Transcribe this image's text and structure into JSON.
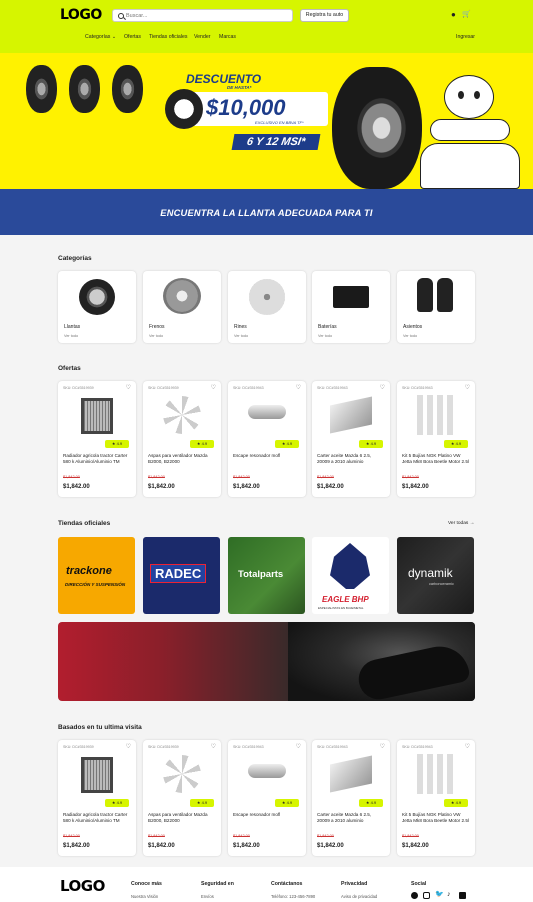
{
  "header": {
    "logo": "LOGO",
    "search_placeholder": "Buscar...",
    "register_label": "Registra tu auto",
    "nav": [
      "Categorías",
      "Ofertas",
      "Tiendas oficiales",
      "Vender",
      "Marcas"
    ],
    "login": "Ingresar",
    "accent": "#d6f500"
  },
  "banner": {
    "line1": "DESCUENTO",
    "line2": "DE HASTA*",
    "amount": "$10,000",
    "exclusive": "EXCLUSIVO EN BBVA TF*",
    "msi": "6 Y 12 MSI*"
  },
  "find_banner": "ENCUENTRA LA LLANTA ADECUADA PARA TI",
  "categories": {
    "title": "Categorías",
    "items": [
      {
        "name": "Llantas",
        "link": "Ver todo"
      },
      {
        "name": "Frenos",
        "link": "Ver todo"
      },
      {
        "name": "Rines",
        "link": "Ver todo"
      },
      {
        "name": "Baterías",
        "link": "Ver todo"
      },
      {
        "name": "Asientos",
        "link": "Ver todo"
      }
    ]
  },
  "offers": {
    "title": "Ofertas",
    "items": [
      {
        "sku": "SKU: DC#3519939",
        "rating": "4.9",
        "name": "Radiador agricola tractor Carter 580 k Aluminio/Aluminio TM",
        "old": "$1,842.00",
        "price": "$1,842.00"
      },
      {
        "sku": "SKU: DC#3519939",
        "rating": "4.9",
        "name": "Aspas para ventilador Mazda B2000, B22000",
        "old": "$1,842.00",
        "price": "$1,842.00"
      },
      {
        "sku": "SKU: DC#3519943",
        "rating": "4.9",
        "name": "Escape resonador mofl",
        "old": "$1,842.00",
        "price": "$1,842.00"
      },
      {
        "sku": "SKU: DC#3519943",
        "rating": "4.9",
        "name": "Carter aceite Mazda 6 2.5, 20009 a 2010 aluminio",
        "old": "$1,842.00",
        "price": "$1,842.00"
      },
      {
        "sku": "SKU: DC#3519943",
        "rating": "4.9",
        "name": "Kit 5 Bujías NGK Platino VW Jetta Mk8 Bora Beetle Motor 2.5l",
        "old": "$1,842.00",
        "price": "$1,842.00"
      }
    ]
  },
  "stores": {
    "title": "Tiendas oficiales",
    "view_all": "Ver todas",
    "brands": [
      "trackone",
      "RADEC",
      "Totalparts",
      "EAGLE BHP",
      "dynamik"
    ],
    "trackone_sub": "DIRECCIÓN Y SUSPENSIÓN",
    "dynamik_sub": "carbonceramic",
    "eagle_sub": "ESPECIALISTAS EN BUJE/METAL"
  },
  "recent": {
    "title": "Basados en tu ultima visita",
    "items": [
      {
        "sku": "SKU: DC#3519939",
        "rating": "4.9",
        "name": "Radiador agricola tractor Carter 580 k Aluminio/Aluminio TM",
        "old": "$1,842.00",
        "price": "$1,842.00"
      },
      {
        "sku": "SKU: DC#3519939",
        "rating": "4.9",
        "name": "Aspas para ventilador Mazda B2000, B22000",
        "old": "$1,842.00",
        "price": "$1,842.00"
      },
      {
        "sku": "SKU: DC#3519943",
        "rating": "4.9",
        "name": "Escape resonador mofl",
        "old": "$1,842.00",
        "price": "$1,842.00"
      },
      {
        "sku": "SKU: DC#3519943",
        "rating": "4.9",
        "name": "Carter aceite Mazda 6 2.5, 20009 a 2010 aluminio",
        "old": "$1,842.00",
        "price": "$1,842.00"
      },
      {
        "sku": "SKU: DC#3519943",
        "rating": "4.9",
        "name": "Kit 5 Bujías NGK Platino VW Jetta Mk8 Bora Beetle Motor 2.5l",
        "old": "$1,842.00",
        "price": "$1,842.00"
      }
    ]
  },
  "footer": {
    "logo": "LOGO",
    "cols": [
      {
        "head": "Conoce más",
        "link": "Nuestra Visión"
      },
      {
        "head": "Seguridad en",
        "link": "Envíos"
      },
      {
        "head": "Contáctanos",
        "link": "Teléfono: 123-456-7890"
      },
      {
        "head": "Privacidad",
        "link": "Aviso de privacidad"
      },
      {
        "head": "Social",
        "link": ""
      }
    ],
    "social_icons": [
      "facebook-icon",
      "instagram-icon",
      "twitter-icon",
      "tiktok-icon",
      "linkedin-icon"
    ]
  }
}
